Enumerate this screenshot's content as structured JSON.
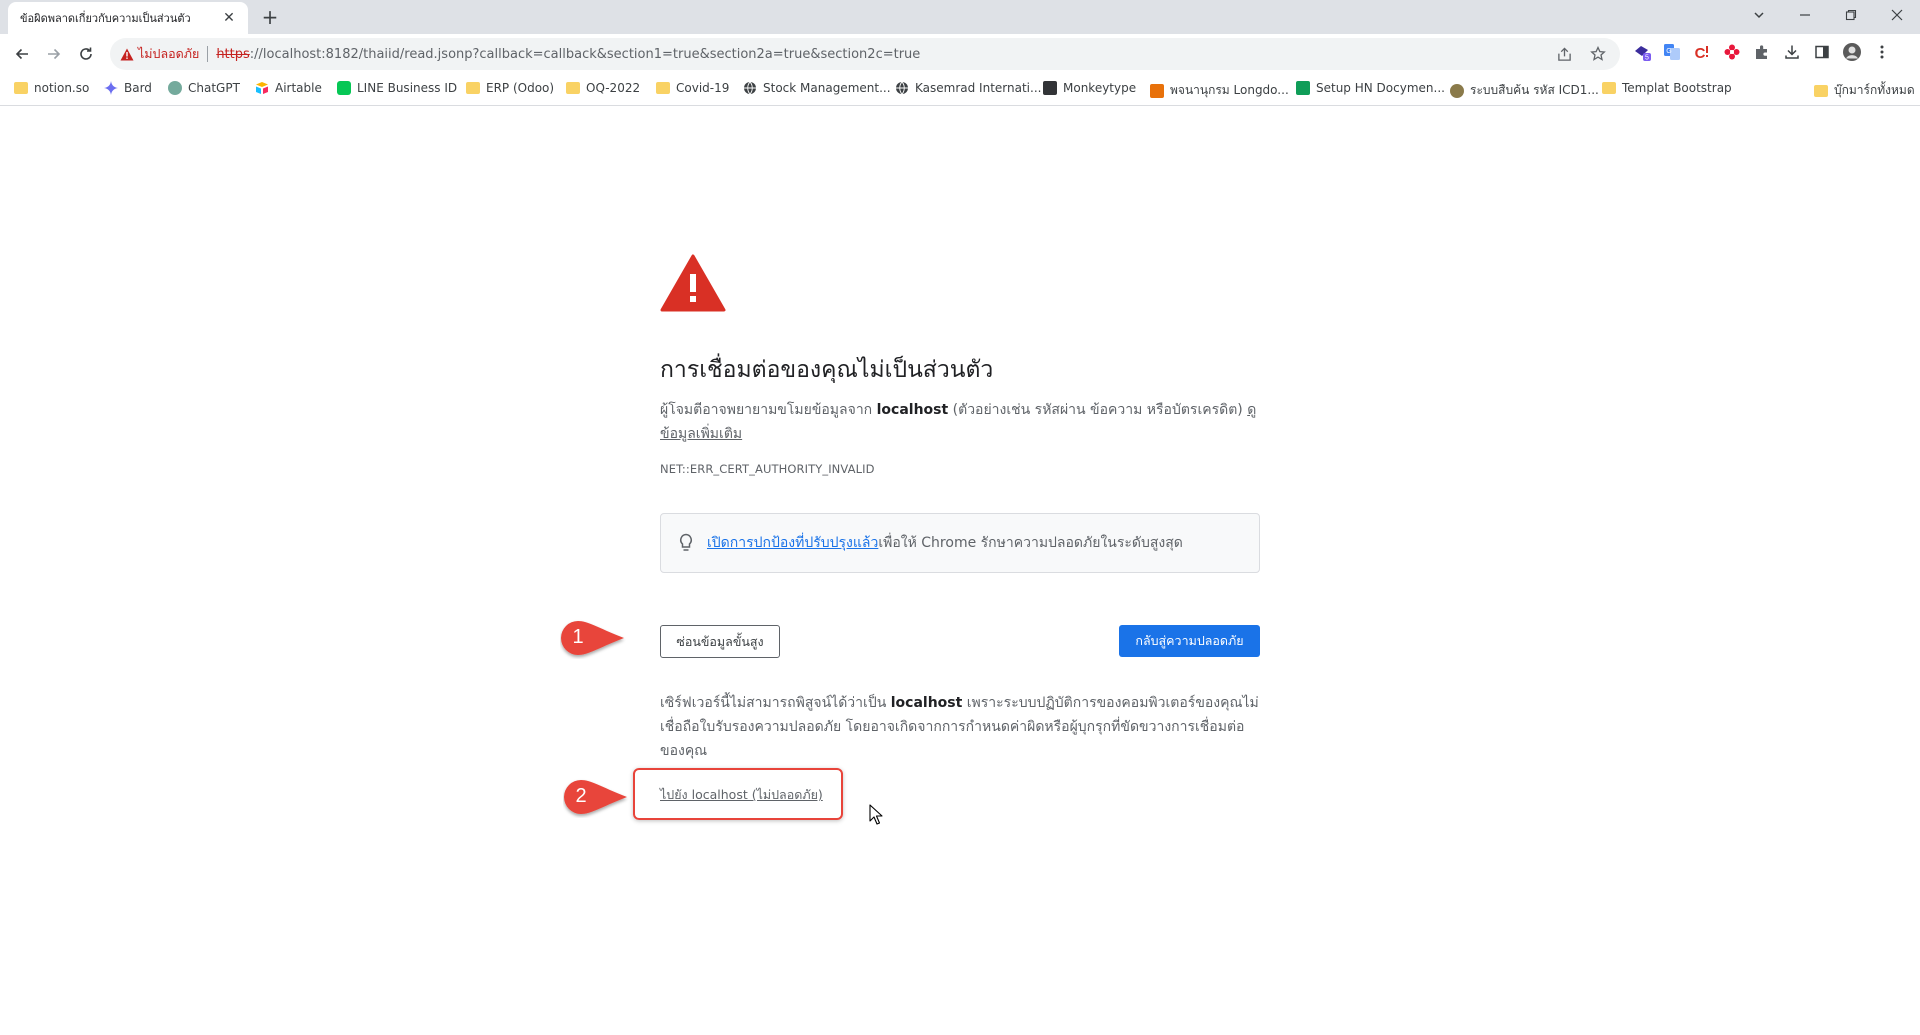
{
  "browser": {
    "tab_title": "ข้อผิดพลาดเกี่ยวกับความเป็นส่วนตัว",
    "tab_close": "✕",
    "new_tab": "+",
    "omnibox": {
      "security_label": "ไม่ปลอดภัย",
      "scheme": "https",
      "url_rest": "://localhost:8182/thaiid/read.jsonp?callback=callback&section1=true&section2a=true&section2c=true"
    }
  },
  "bookmarks": [
    {
      "label": "notion.so",
      "icon": "notion-icon",
      "color": "#f9d264"
    },
    {
      "label": "Bard",
      "icon": "bard-icon",
      "color": "#4285f4"
    },
    {
      "label": "ChatGPT",
      "icon": "chatgpt-icon",
      "color": "#74aa9c"
    },
    {
      "label": "Airtable",
      "icon": "airtable-icon",
      "color": "#fcb400"
    },
    {
      "label": "LINE Business ID",
      "icon": "line-icon",
      "color": "#06c755"
    },
    {
      "label": "ERP (Odoo)",
      "icon": "folder-icon",
      "color": "#f9d264"
    },
    {
      "label": "OQ-2022",
      "icon": "folder-icon",
      "color": "#f9d264"
    },
    {
      "label": "Covid-19",
      "icon": "folder-icon",
      "color": "#f9d264"
    },
    {
      "label": "Stock Management...",
      "icon": "globe-icon",
      "color": "#3c4043"
    },
    {
      "label": "Kasemrad Internati...",
      "icon": "globe-icon",
      "color": "#3c4043"
    },
    {
      "label": "Monkeytype",
      "icon": "monkeytype-icon",
      "color": "#323437"
    },
    {
      "label": "พจนานุกรม Longdo...",
      "icon": "longdo-icon",
      "color": "#e8710a"
    },
    {
      "label": "Setup HN Docymen...",
      "icon": "sheets-icon",
      "color": "#0f9d58"
    },
    {
      "label": "ระบบสืบค้น รหัส ICD1...",
      "icon": "seal-icon",
      "color": "#8a7a4a"
    },
    {
      "label": "Templat Bootstrap",
      "icon": "folder-icon",
      "color": "#f9d264"
    },
    {
      "label": "บุ๊กมาร์กทั้งหมด",
      "icon": "folder-icon",
      "color": "#f9d264"
    }
  ],
  "interstitial": {
    "headline": "การเชื่อมต่อของคุณไม่เป็นส่วนตัว",
    "desc_before": "ผู้โจมตีอาจพยายามขโมยข้อมูลจาก ",
    "desc_host": "localhost",
    "desc_after": " (ตัวอย่างเช่น รหัสผ่าน ข้อความ หรือบัตรเครดิต) ",
    "learn_more": "ดูข้อมูลเพิ่มเติม",
    "error_code": "NET::ERR_CERT_AUTHORITY_INVALID",
    "safe_link": "เปิดการปกป้องที่ปรับปรุงแล้ว",
    "safe_text": "เพื่อให้ Chrome รักษาความปลอดภัยในระดับสูงสุด",
    "advanced_button": "ซ่อนข้อมูลขั้นสูง",
    "back_button": "กลับสู่ความปลอดภัย",
    "detail_before": "เซิร์ฟเวอร์นี้ไม่สามารถพิสูจน์ได้ว่าเป็น ",
    "detail_host": "localhost",
    "detail_after": " เพราะระบบปฏิบัติการของคอมพิวเตอร์ของคุณไม่เชื่อถือใบรับรองความปลอดภัย โดยอาจเกิดจากการกำหนดค่าผิดหรือผู้บุกรุกที่ขัดขวางการเชื่อมต่อของคุณ",
    "proceed_link": "ไปยัง localhost (ไม่ปลอดภัย)"
  },
  "annotations": {
    "marker_1": "1",
    "marker_2": "2",
    "marker_color": "#e8443a"
  }
}
